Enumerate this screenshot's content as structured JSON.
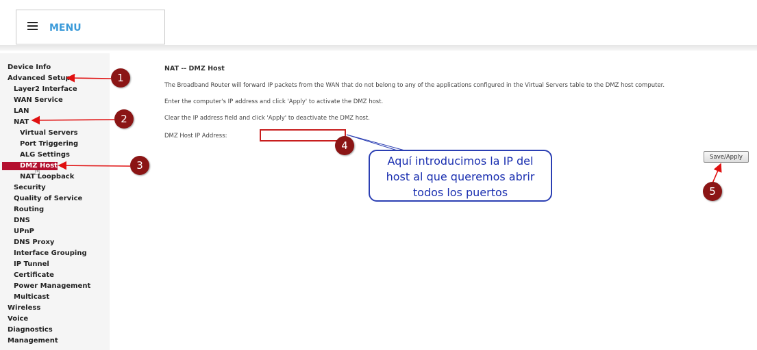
{
  "header": {
    "menu_label": "MENU"
  },
  "sidebar": {
    "items": [
      {
        "label": "Device Info"
      },
      {
        "label": "Advanced Setup"
      },
      {
        "label": "Layer2 Interface"
      },
      {
        "label": "WAN Service"
      },
      {
        "label": "LAN"
      },
      {
        "label": "NAT"
      },
      {
        "label": "Virtual Servers"
      },
      {
        "label": "Port Triggering"
      },
      {
        "label": "ALG Settings"
      },
      {
        "label": "DMZ Host"
      },
      {
        "label": "NAT Loopback"
      },
      {
        "label": "Security"
      },
      {
        "label": "Quality of Service"
      },
      {
        "label": "Routing"
      },
      {
        "label": "DNS"
      },
      {
        "label": "UPnP"
      },
      {
        "label": "DNS Proxy"
      },
      {
        "label": "Interface Grouping"
      },
      {
        "label": "IP Tunnel"
      },
      {
        "label": "Certificate"
      },
      {
        "label": "Power Management"
      },
      {
        "label": "Multicast"
      },
      {
        "label": "Wireless"
      },
      {
        "label": "Voice"
      },
      {
        "label": "Diagnostics"
      },
      {
        "label": "Management"
      }
    ]
  },
  "main": {
    "title": "NAT -- DMZ Host",
    "description": "The Broadband Router will forward IP packets from the WAN that do not belong to any of the applications configured in the Virtual Servers table to the DMZ host computer.",
    "instruction_activate": "Enter the computer's IP address and click 'Apply' to activate the DMZ host.",
    "instruction_deactivate": "Clear the IP address field and click 'Apply' to deactivate the DMZ host.",
    "ip_field_label": "DMZ Host IP Address:",
    "ip_field_value": "",
    "save_label": "Save/Apply"
  },
  "annotations": {
    "markers": [
      "1",
      "2",
      "3",
      "4",
      "5"
    ],
    "callout_lines": [
      "Aquí introducimos la IP del",
      "host al que queremos abrir",
      "todos los puertos"
    ]
  },
  "colors": {
    "accent": "#3a9ad9",
    "active_item": "#b4102f",
    "marker": "#8b1515",
    "arrow": "#e01010",
    "callout": "#2b3fb3"
  },
  "icons": {
    "menu": "hamburger-icon",
    "cursor": "hand-pointer-icon"
  }
}
